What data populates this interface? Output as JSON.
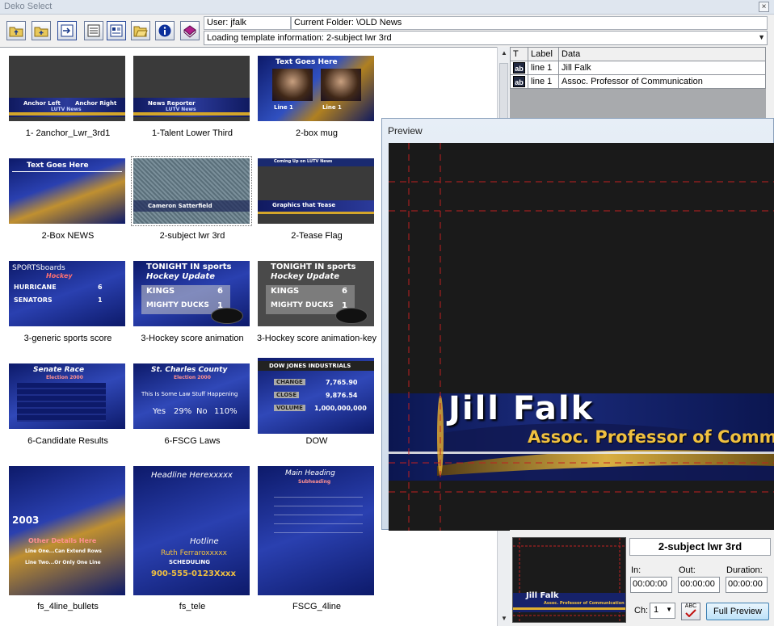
{
  "window": {
    "title": "Deko Select",
    "close_glyph": "×"
  },
  "toolbar": {
    "buttons": [
      {
        "icon": "folder-up-icon"
      },
      {
        "icon": "new-folder-icon"
      },
      {
        "icon": "import-icon"
      },
      {
        "icon": "list-view-icon"
      },
      {
        "icon": "detail-view-icon"
      },
      {
        "icon": "open-folder-icon"
      },
      {
        "icon": "info-icon"
      },
      {
        "icon": "book-icon"
      }
    ]
  },
  "info": {
    "user": "User: jfalk",
    "folder": "Current Folder: \\OLD News",
    "status": "Loading template information: 2-subject lwr 3rd",
    "dropdown_glyph": "▼"
  },
  "templates": [
    {
      "label": "1- 2anchor_Lwr_3rd1",
      "texts": [
        "Anchor Left",
        "Anchor Right",
        "LUTV News"
      ]
    },
    {
      "label": "1-Talent Lower Third",
      "texts": [
        "News Reporter",
        "LUTV News"
      ]
    },
    {
      "label": "2-box mug",
      "texts": [
        "Text Goes Here",
        "Line 1",
        "Line 1"
      ]
    },
    {
      "label": "2-Box NEWS",
      "texts": [
        "Text Goes Here"
      ]
    },
    {
      "label": "2-subject lwr 3rd",
      "texts": [
        "Cameron Satterfield"
      ],
      "selected": true
    },
    {
      "label": "2-Tease Flag",
      "texts": [
        "Coming Up on LUTV News",
        "Graphics that Tease"
      ]
    },
    {
      "label": "3-generic sports score",
      "texts": [
        "SPORTSboards",
        "Hockey",
        "HURRICANE",
        "SENATORS",
        "6",
        "1"
      ]
    },
    {
      "label": "3-Hockey score animation",
      "texts": [
        "TONIGHT IN sports",
        "Hockey Update",
        "KINGS",
        "MIGHTY DUCKS",
        "6",
        "1"
      ]
    },
    {
      "label": "3-Hockey score animation-key",
      "texts": [
        "TONIGHT IN sports",
        "Hockey Update",
        "KINGS",
        "MIGHTY DUCKS",
        "6",
        "1"
      ]
    },
    {
      "label": "6-Candidate Results",
      "texts": [
        "Senate Race",
        "Election 2000"
      ]
    },
    {
      "label": "6-FSCG Laws",
      "texts": [
        "St. Charles County",
        "Election 2000",
        "This Is Some Law Stuff Happening",
        "Yes",
        "29%",
        "No",
        "110%"
      ]
    },
    {
      "label": "DOW",
      "texts": [
        "DOW JONES INDUSTRIALS",
        "CHANGE",
        "CLOSE",
        "VOLUME",
        "7,765.90",
        "9,876.54",
        "1,000,000,000"
      ]
    },
    {
      "label": "fs_4line_bullets",
      "texts": [
        "2003",
        "Other Details Here",
        "Line One...Can Extend Rows",
        "Line Two...Or Only One Line"
      ]
    },
    {
      "label": "fs_tele",
      "texts": [
        "Headline Herexxxxx",
        "Hotline",
        "Ruth Ferraroxxxxx",
        "SCHEDULING",
        "900-555-0123Xxxx"
      ]
    },
    {
      "label": "FSCG_4line",
      "texts": [
        "Main Heading",
        "Subheading"
      ]
    }
  ],
  "scrollbar": {
    "up": "▲",
    "down": "▼"
  },
  "grid": {
    "headers": [
      "T",
      "Label",
      "Data"
    ],
    "rows": [
      {
        "type": "ab",
        "label": "line 1",
        "data": "Jill Falk"
      },
      {
        "type": "ab",
        "label": "line 1",
        "data": "Assoc. Professor of Communication"
      }
    ]
  },
  "preview": {
    "title": "Preview",
    "name": "Jill Falk",
    "subtitle": "Assoc. Professor of Communication"
  },
  "bottom": {
    "template_name": "2-subject lwr 3rd",
    "in_label": "In:",
    "out_label": "Out:",
    "duration_label": "Duration:",
    "in_value": "00:00:00",
    "out_value": "00:00:00",
    "duration_value": "00:00:00",
    "ch_label": "Ch:",
    "ch_value": "1",
    "spell_label": "ABC",
    "full_preview": "Full Preview"
  },
  "colors": {
    "accent_blue": "#1b2a8a",
    "gold": "#e0b030",
    "highlight": "#3c7fb1"
  }
}
